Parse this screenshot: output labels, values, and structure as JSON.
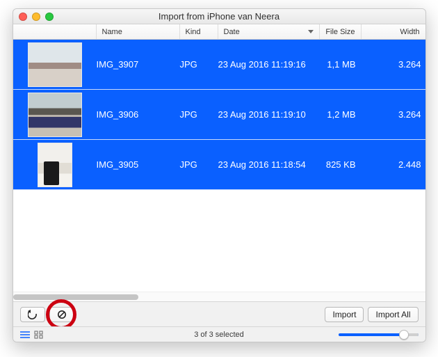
{
  "window": {
    "title": "Import from iPhone van Neera"
  },
  "columns": {
    "name": "Name",
    "kind": "Kind",
    "date": "Date",
    "size": "File Size",
    "width": "Width"
  },
  "rows": [
    {
      "name": "IMG_3907",
      "kind": "JPG",
      "date": "23 Aug 2016 11:19:16",
      "size": "1,1 MB",
      "width": "3.264"
    },
    {
      "name": "IMG_3906",
      "kind": "JPG",
      "date": "23 Aug 2016 11:19:10",
      "size": "1,2 MB",
      "width": "3.264"
    },
    {
      "name": "IMG_3905",
      "kind": "JPG",
      "date": "23 Aug 2016 11:18:54",
      "size": "825 KB",
      "width": "2.448"
    }
  ],
  "toolbar": {
    "import": "Import",
    "import_all": "Import All"
  },
  "status": {
    "text": "3 of 3 selected"
  }
}
